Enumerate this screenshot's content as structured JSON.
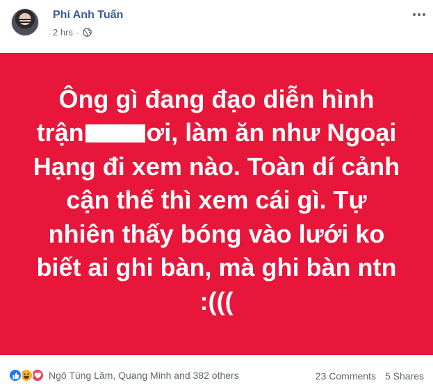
{
  "post": {
    "author": "Phí Anh Tuấn",
    "timestamp": "2 hrs",
    "privacy_icon": "globe-icon",
    "more_icon": "more-icon",
    "banner_color": "#e8163a",
    "text_lines": [
      "Ông gì đang đạo diễn hình",
      "ơi, làm ăn như Ngoại",
      "Hạng đi xem nào. Toàn dí cảnh",
      "cận thế thì xem cái gì. Tự",
      "nhiên thấy bóng vào lưới ko",
      "biết ai ghi bàn, mà ghi bàn ntn",
      ":((("
    ],
    "line2_prefix": "trận"
  },
  "footer": {
    "reaction_icons": [
      "like-icon",
      "haha-icon",
      "love-icon"
    ],
    "reactors": "Ngô Tùng Lâm, Quang Minh and 382 others",
    "comments": "23 Comments",
    "shares": "5 Shares"
  }
}
